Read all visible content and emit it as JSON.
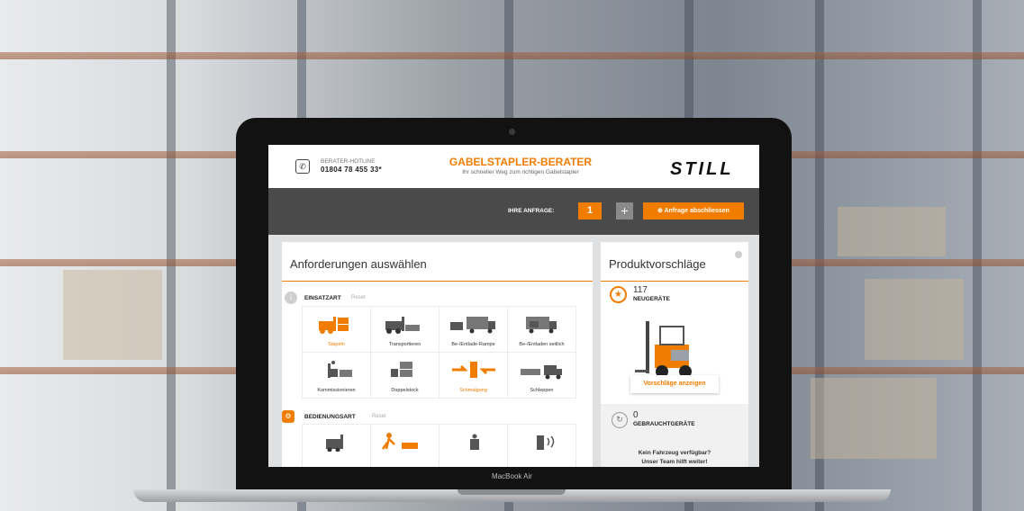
{
  "device": {
    "label": "MacBook Air"
  },
  "header": {
    "hotline_label": "BERATER-HOTLINE",
    "hotline_number": "01804 78 455 33*",
    "title": "GABELSTAPLER-BERATER",
    "subtitle": "Ihr schneller Weg zum richtigen Gabelstapler",
    "logo": "STILL"
  },
  "toolbar": {
    "anfrage_label": "IHRE ANFRAGE:",
    "anfrage_count": "1",
    "add_label": "+",
    "finish_label": "⊕ Anfrage abschliessen"
  },
  "main": {
    "title": "Anforderungen auswählen",
    "sections": [
      {
        "label": "EINSATZART",
        "reset": "Reset",
        "tiles": [
          "Stapeln",
          "Transportieren",
          "Be-/Entlade-Rampe",
          "Be-/Entladen seitlich",
          "Kommissionieren",
          "Doppelstock",
          "Schmalgang",
          "Schleppen"
        ]
      },
      {
        "label": "BEDIENUNGSART",
        "reset": "Reset"
      }
    ]
  },
  "sidebar": {
    "title": "Produktvorschläge",
    "new_count": "117",
    "new_label": "NEUGERÄTE",
    "show_button": "Vorschläge anzeigen",
    "used_count": "0",
    "used_label": "GEBRAUCHTGERÄTE",
    "empty_line1": "Kein Fahrzeug verfügbar?",
    "empty_line2": "Unser Team hilft weiter!"
  },
  "colors": {
    "accent": "#f07d00",
    "bar": "#4a4a4a"
  }
}
